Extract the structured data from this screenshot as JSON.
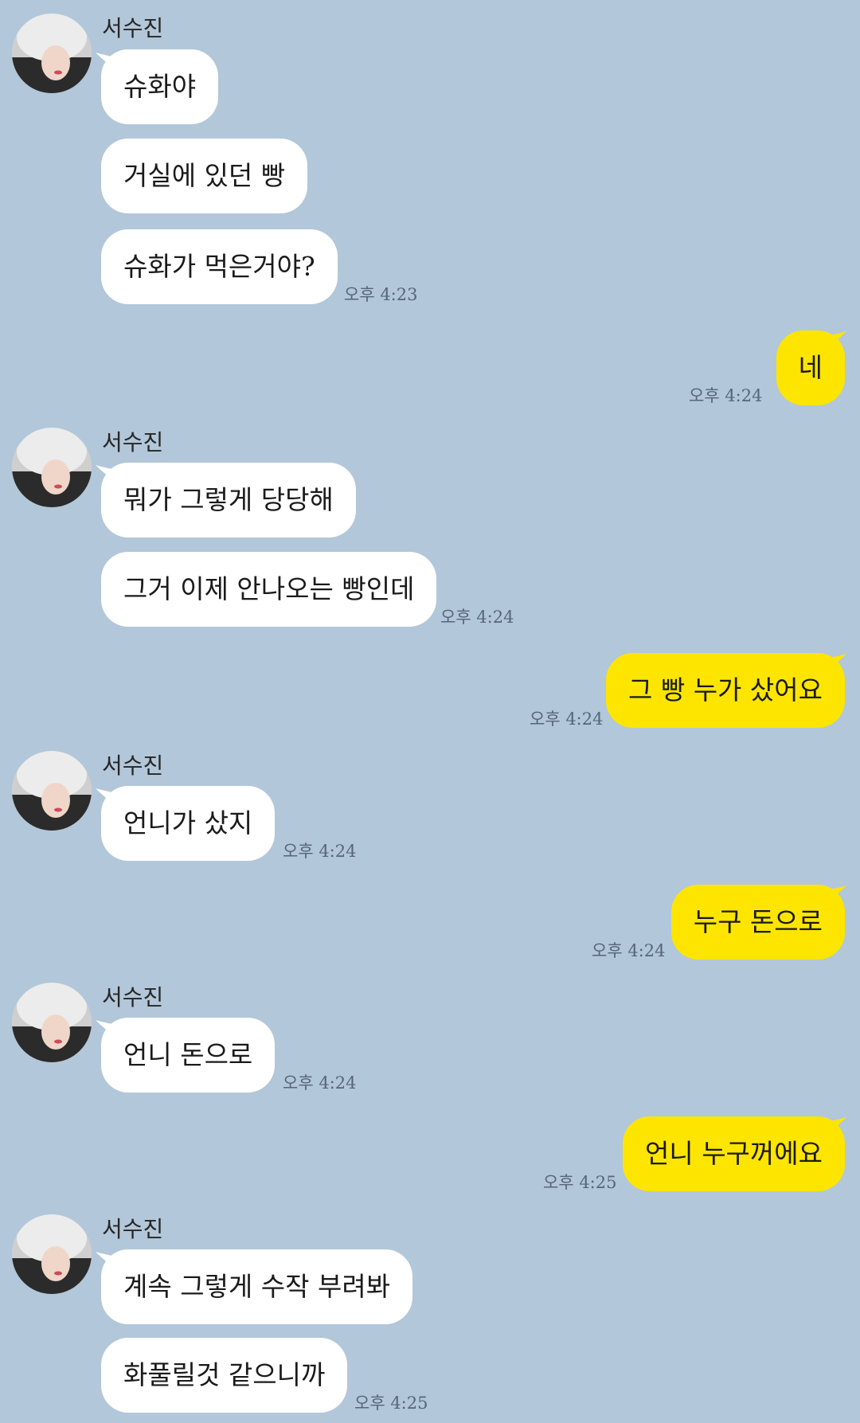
{
  "contact": {
    "name": "서수진"
  },
  "colors": {
    "background": "#b2c7d9",
    "incoming_bubble": "#ffffff",
    "outgoing_bubble": "#fee500"
  },
  "icons": {
    "avatar": "profile-photo",
    "bubble_tail": "speech-tail"
  },
  "messages": [
    {
      "from": "서수진",
      "text": "슈화야"
    },
    {
      "from": "서수진",
      "text": "거실에 있던 빵"
    },
    {
      "from": "서수진",
      "text": "슈화가 먹은거야?",
      "time": "오후 4:23"
    },
    {
      "from": "me",
      "text": "네",
      "time": "오후 4:24"
    },
    {
      "from": "서수진",
      "text": "뭐가 그렇게 당당해"
    },
    {
      "from": "서수진",
      "text": "그거 이제 안나오는 빵인데",
      "time": "오후 4:24"
    },
    {
      "from": "me",
      "text": "그 빵 누가 샀어요",
      "time": "오후 4:24"
    },
    {
      "from": "서수진",
      "text": "언니가 샀지",
      "time": "오후 4:24"
    },
    {
      "from": "me",
      "text": "누구 돈으로",
      "time": "오후 4:24"
    },
    {
      "from": "서수진",
      "text": "언니 돈으로",
      "time": "오후 4:24"
    },
    {
      "from": "me",
      "text": "언니 누구꺼에요",
      "time": "오후 4:25"
    },
    {
      "from": "서수진",
      "text": "계속 그렇게 수작 부려봐"
    },
    {
      "from": "서수진",
      "text": "화풀릴것 같으니까",
      "time": "오후 4:25"
    }
  ]
}
